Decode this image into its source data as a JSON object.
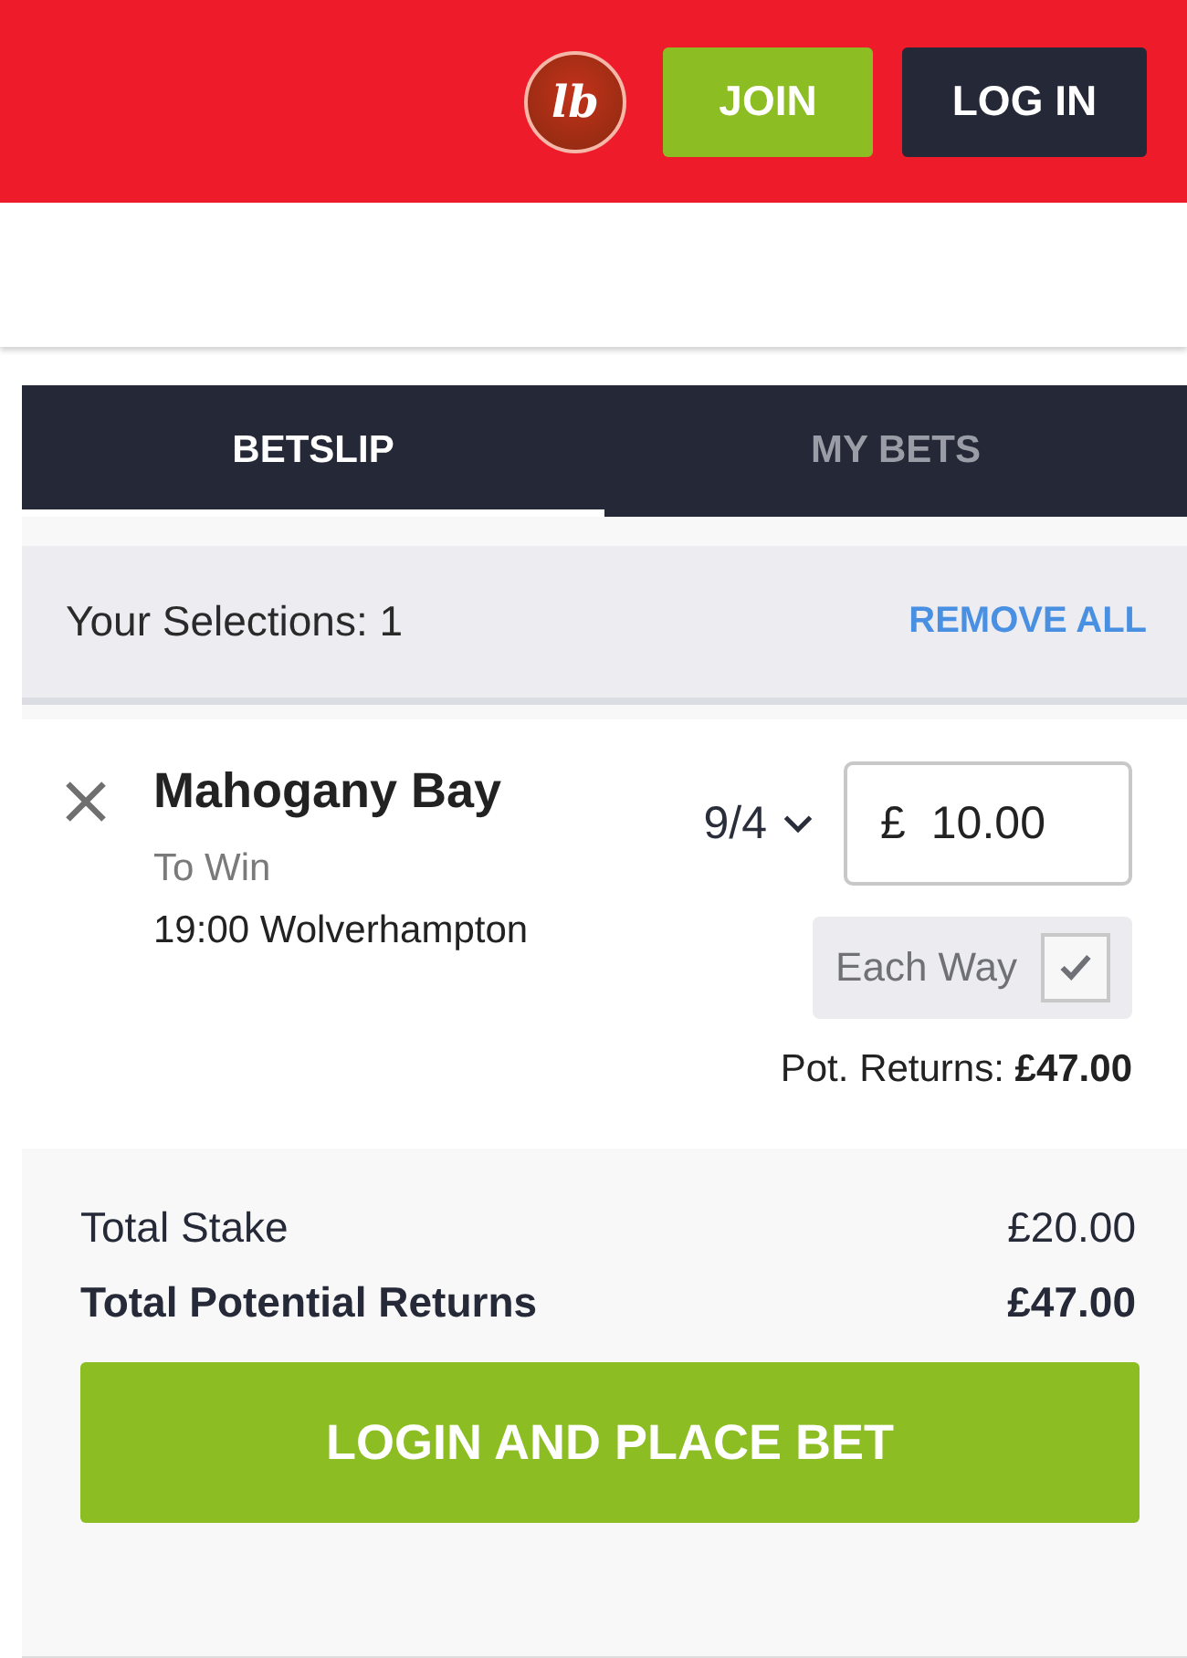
{
  "header": {
    "logo_text": "lb",
    "buttons": [
      {
        "label": "JOIN",
        "kind": "join"
      },
      {
        "label": "LOG IN",
        "kind": "login"
      }
    ]
  },
  "tabs": [
    {
      "label": "BETSLIP",
      "selected": true
    },
    {
      "label": "MY BETS",
      "selected": false
    }
  ],
  "selections_bar": {
    "label": "Your Selections: 1",
    "action": "REMOVE ALL"
  },
  "selections": [
    {
      "name": "Mahogany Bay",
      "market": "To Win",
      "event": "19:00 Wolverhampton",
      "odds": "9/4",
      "currency": "£",
      "stake": "10.00",
      "each_way_label": "Each Way",
      "each_way": true,
      "returns_label": "Pot. Returns:",
      "returns": "£47.00"
    }
  ],
  "totals": [
    {
      "label": "Total Stake",
      "value": "£20.00",
      "kind": "normal"
    },
    {
      "label": "Total Potential Returns",
      "value": "£47.00",
      "kind": "strong"
    }
  ],
  "place_bet": "LOGIN AND PLACE BET"
}
